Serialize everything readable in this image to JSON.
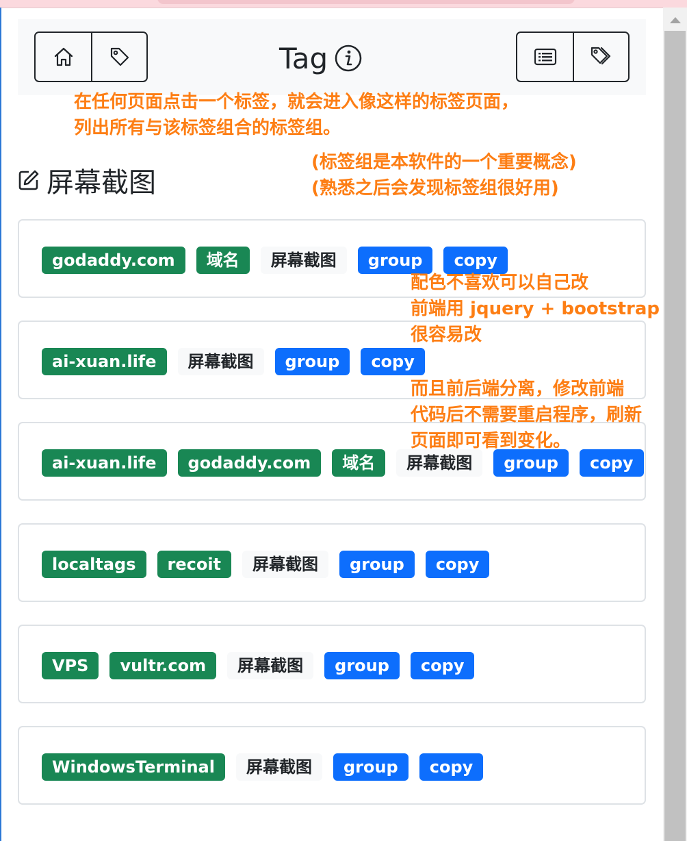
{
  "header": {
    "title": "Tag",
    "left_buttons": [
      "home-icon",
      "tag-icon"
    ],
    "right_buttons": [
      "list-icon",
      "tags-icon"
    ]
  },
  "section": {
    "icon": "pencil-square-icon",
    "title": "屏幕截图"
  },
  "notes": {
    "intro": [
      "在任何页面点击一个标签，就会进入像这样的标签页面，",
      "列出所有与该标签组合的标签组。"
    ],
    "concept": [
      "(标签组是本软件的一个重要概念)",
      "(熟悉之后会发现标签组很好用)"
    ],
    "style": [
      "配色不喜欢可以自己改",
      "前端用 jquery + bootstrap",
      "很容易改"
    ],
    "frontend": [
      "而且前后端分离，修改前端",
      "代码后不需要重启程序，刷新",
      "页面即可看到变化。"
    ]
  },
  "groups": [
    {
      "tags": [
        "godaddy.com",
        "域名",
        "屏幕截图",
        "group",
        "copy"
      ]
    },
    {
      "tags": [
        "ai-xuan.life",
        "屏幕截图",
        "group",
        "copy"
      ]
    },
    {
      "tags": [
        "ai-xuan.life",
        "godaddy.com",
        "域名",
        "屏幕截图",
        "group",
        "copy"
      ]
    },
    {
      "tags": [
        "localtags",
        "recoit",
        "屏幕截图",
        "group",
        "copy"
      ]
    },
    {
      "tags": [
        "VPS",
        "vultr.com",
        "屏幕截图",
        "group",
        "copy"
      ]
    },
    {
      "tags": [
        "WindowsTerminal",
        "屏幕截图",
        "group",
        "copy"
      ]
    }
  ],
  "colors": {
    "tag_green": "#198754",
    "tag_blue": "#0d6efd",
    "tag_light": "#f8f9fa",
    "annotation": "#fd7e14"
  }
}
